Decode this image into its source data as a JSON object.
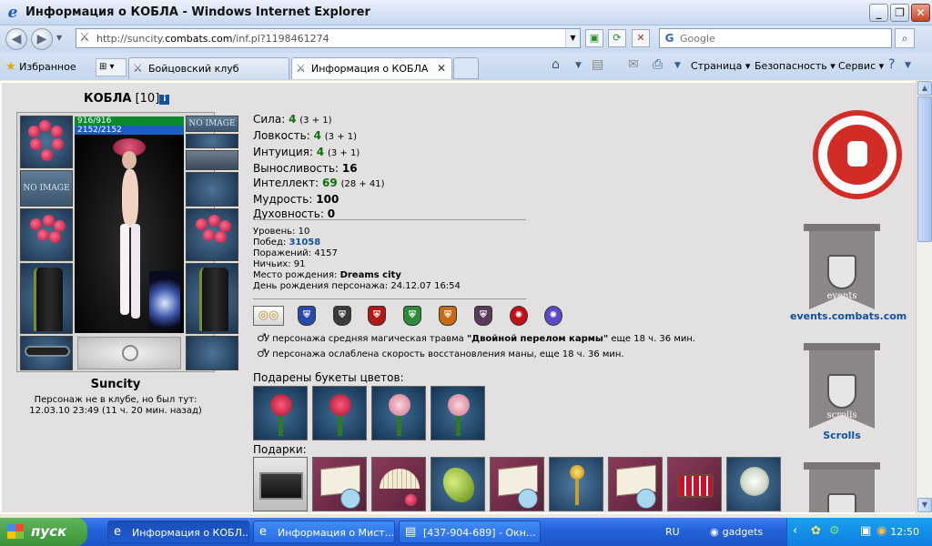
{
  "window": {
    "title": "Информация о КОБЛА - Windows Internet Explorer"
  },
  "nav": {
    "url_host_prefix": "http://suncity.",
    "url_domain": "combats.com",
    "url_path": "/inf.pl?1198461274",
    "search_placeholder": "Google"
  },
  "tabs": {
    "favorites_label": "Избранное",
    "items": [
      "Бойцовский клуб",
      "Информация о КОБЛА"
    ]
  },
  "commands": {
    "page": "Страница",
    "safety": "Безопасность",
    "service": "Сервис"
  },
  "profile": {
    "nick": "КОБЛА",
    "level_tag": "[10]",
    "hp": "916/916",
    "mp": "2152/2152",
    "no_image": "NO IMAGE",
    "city": "Suncity",
    "club_line1": "Персонаж не в клубе, но был тут:",
    "club_line2": "12.03.10 23:49 (11 ч. 20 мин. назад)"
  },
  "stats": [
    {
      "label": "Сила:",
      "value": "4",
      "mod": "(3 + 1)"
    },
    {
      "label": "Ловкость:",
      "value": "4",
      "mod": "(3 + 1)"
    },
    {
      "label": "Интуиция:",
      "value": "4",
      "mod": "(3 + 1)"
    },
    {
      "label": "Выносливость:",
      "value": "16",
      "mod": ""
    },
    {
      "label": "Интеллект:",
      "value": "69",
      "mod": "(28 + 41)"
    },
    {
      "label": "Мудрость:",
      "value": "100",
      "mod": ""
    },
    {
      "label": "Духовность:",
      "value": "0",
      "mod": ""
    }
  ],
  "info": {
    "level_label": "Уровень:",
    "level": "10",
    "wins_label": "Побед:",
    "wins": "31058",
    "losses_label": "Поражений:",
    "losses": "4157",
    "draws_label": "Ничьих:",
    "draws": "91",
    "birthplace_label": "Место рождения:",
    "birthplace": "Dreams city",
    "birthday_label": "День рождения персонажа:",
    "birthday": "24.12.07 16:54"
  },
  "effects": [
    {
      "pre": "У персонажа средняя магическая травма ",
      "name": "\"Двойной перелом кармы\"",
      "post": " еще 18 ч. 36 мин."
    },
    {
      "pre": "У персонажа ослаблена скорость восстановления маны, еще 18 ч. 36 мин.",
      "name": "",
      "post": ""
    }
  ],
  "flowers_title": "Подарены букеты цветов:",
  "gifts_title": "Подарки:",
  "side": {
    "events_banner": "events",
    "events_link": "events.combats.com",
    "scrolls_banner": "scrolls",
    "scrolls_link": "Scrolls"
  },
  "taskbar": {
    "start": "пуск",
    "items": [
      "Информация о КОБЛ...",
      "Информация о Мист...",
      "[437-904-689] - Окн..."
    ],
    "lang": "RU",
    "gadgets": "gadgets",
    "clock": "12:50"
  },
  "colors": {
    "title_bar": "#c6d7f0",
    "page_bg": "#e2e0e0",
    "hp": "#0a8a2a",
    "mp": "#1b5fbb",
    "logo_red": "#d12c25",
    "taskbar": "#2563dc",
    "start": "#3a9338"
  }
}
